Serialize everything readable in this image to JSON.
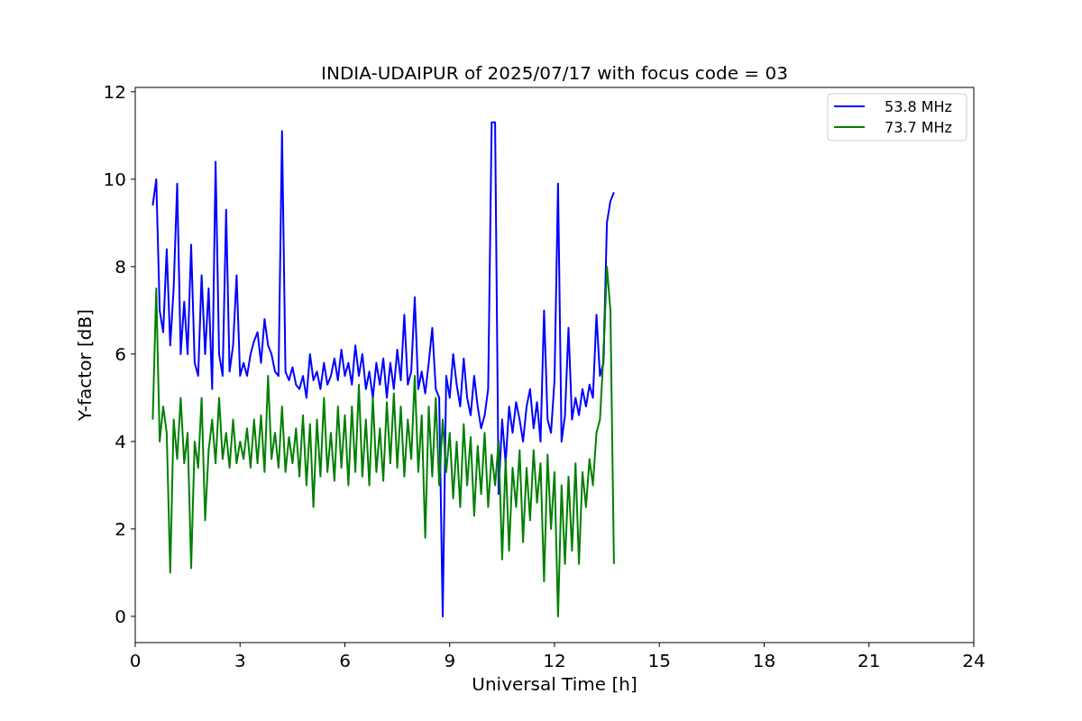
{
  "plot": {
    "chart_data": {
      "type": "line",
      "title": "INDIA-UDAIPUR of 2025/07/17 with focus code = 03",
      "xlabel": "Universal Time [h]",
      "ylabel": "Y-factor [dB]",
      "xlim": [
        0,
        24
      ],
      "ylim": [
        -0.6,
        12.1
      ],
      "xticks": [
        0,
        3,
        6,
        9,
        12,
        15,
        18,
        21,
        24
      ],
      "yticks": [
        0,
        2,
        4,
        6,
        8,
        10,
        12
      ],
      "legend": "upper right",
      "x": [
        0.5,
        0.6,
        0.7,
        0.8,
        0.9,
        1.0,
        1.1,
        1.2,
        1.3,
        1.4,
        1.5,
        1.6,
        1.7,
        1.8,
        1.9,
        2.0,
        2.1,
        2.2,
        2.3,
        2.4,
        2.5,
        2.6,
        2.7,
        2.8,
        2.9,
        3.0,
        3.1,
        3.2,
        3.3,
        3.4,
        3.5,
        3.6,
        3.7,
        3.8,
        3.9,
        4.0,
        4.1,
        4.2,
        4.3,
        4.4,
        4.5,
        4.6,
        4.7,
        4.8,
        4.9,
        5.0,
        5.1,
        5.2,
        5.3,
        5.4,
        5.5,
        5.6,
        5.7,
        5.8,
        5.9,
        6.0,
        6.1,
        6.2,
        6.3,
        6.4,
        6.5,
        6.6,
        6.7,
        6.8,
        6.9,
        7.0,
        7.1,
        7.2,
        7.3,
        7.4,
        7.5,
        7.6,
        7.7,
        7.8,
        7.9,
        8.0,
        8.1,
        8.2,
        8.3,
        8.4,
        8.5,
        8.6,
        8.7,
        8.8,
        8.9,
        9.0,
        9.1,
        9.2,
        9.3,
        9.4,
        9.5,
        9.6,
        9.7,
        9.8,
        9.9,
        10.0,
        10.1,
        10.2,
        10.3,
        10.4,
        10.5,
        10.6,
        10.7,
        10.8,
        10.9,
        11.0,
        11.1,
        11.2,
        11.3,
        11.4,
        11.5,
        11.6,
        11.7,
        11.8,
        11.9,
        12.0,
        12.1,
        12.2,
        12.3,
        12.4,
        12.5,
        12.6,
        12.7,
        12.8,
        12.9,
        13.0,
        13.1,
        13.2,
        13.3,
        13.4,
        13.5,
        13.6,
        13.7
      ],
      "series": [
        {
          "name": "53.8 MHz",
          "color": "#0000ff",
          "values": [
            9.4,
            10.0,
            7.0,
            6.5,
            8.4,
            6.2,
            7.5,
            9.9,
            6.0,
            7.2,
            6.0,
            8.5,
            5.8,
            5.5,
            7.8,
            6.0,
            7.5,
            5.2,
            10.4,
            6.0,
            5.5,
            9.3,
            5.6,
            6.2,
            7.8,
            5.5,
            5.8,
            5.5,
            6.0,
            6.3,
            6.5,
            5.8,
            6.8,
            6.2,
            6.0,
            5.6,
            5.5,
            11.1,
            5.6,
            5.4,
            5.7,
            5.3,
            5.2,
            5.5,
            5.0,
            6.0,
            5.4,
            5.6,
            5.2,
            5.8,
            5.3,
            5.5,
            5.9,
            5.4,
            6.1,
            5.5,
            5.8,
            5.3,
            6.2,
            5.5,
            6.0,
            5.2,
            5.6,
            5.0,
            5.8,
            5.3,
            5.9,
            5.0,
            5.8,
            5.2,
            6.1,
            5.4,
            6.9,
            5.3,
            5.6,
            7.3,
            5.2,
            5.6,
            5.1,
            5.8,
            6.6,
            5.2,
            5.0,
            0.0,
            5.5,
            5.0,
            6.0,
            5.3,
            4.8,
            5.9,
            5.0,
            4.6,
            5.5,
            4.8,
            4.3,
            4.6,
            5.2,
            11.3,
            11.3,
            2.8,
            4.5,
            3.5,
            4.8,
            4.2,
            4.9,
            4.5,
            4.0,
            4.8,
            5.2,
            4.3,
            4.9,
            4.0,
            7.0,
            4.5,
            4.2,
            5.4,
            9.9,
            4.0,
            4.6,
            6.6,
            4.5,
            5.0,
            4.6,
            5.2,
            4.8,
            5.3,
            5.0,
            6.9,
            5.5,
            5.8,
            9.0,
            9.5,
            9.7
          ]
        },
        {
          "name": "73.7 MHz",
          "color": "#008000",
          "values": [
            4.5,
            7.5,
            4.0,
            4.8,
            4.2,
            1.0,
            4.5,
            3.6,
            5.0,
            3.5,
            4.2,
            1.1,
            4.0,
            3.4,
            5.0,
            2.2,
            3.8,
            4.5,
            3.5,
            5.0,
            3.6,
            4.2,
            3.4,
            4.5,
            3.5,
            4.0,
            3.6,
            4.3,
            3.4,
            4.5,
            3.5,
            4.6,
            3.3,
            5.5,
            3.6,
            4.2,
            3.4,
            4.8,
            3.3,
            4.1,
            3.5,
            4.3,
            3.2,
            4.6,
            3.0,
            4.4,
            2.5,
            4.5,
            3.2,
            5.0,
            3.3,
            4.2,
            3.1,
            4.8,
            3.4,
            4.6,
            3.0,
            4.8,
            3.3,
            5.3,
            3.2,
            4.5,
            3.0,
            5.0,
            3.3,
            4.3,
            3.1,
            4.9,
            3.5,
            5.1,
            3.4,
            4.8,
            3.2,
            4.5,
            3.6,
            5.5,
            3.3,
            4.6,
            1.8,
            4.8,
            3.2,
            5.0,
            3.0,
            4.5,
            3.3,
            4.2,
            2.7,
            4.0,
            2.5,
            4.4,
            3.0,
            4.1,
            2.3,
            3.9,
            2.8,
            4.2,
            2.5,
            3.7,
            3.0,
            4.0,
            1.3,
            3.6,
            1.5,
            3.4,
            2.5,
            3.8,
            1.7,
            3.4,
            2.2,
            3.8,
            2.6,
            3.5,
            0.8,
            3.7,
            2.0,
            3.3,
            0.0,
            3.0,
            1.2,
            3.2,
            1.5,
            3.5,
            1.2,
            3.3,
            2.5,
            3.6,
            3.0,
            4.2,
            4.5,
            6.0,
            8.0,
            7.0,
            1.2
          ]
        }
      ]
    }
  }
}
